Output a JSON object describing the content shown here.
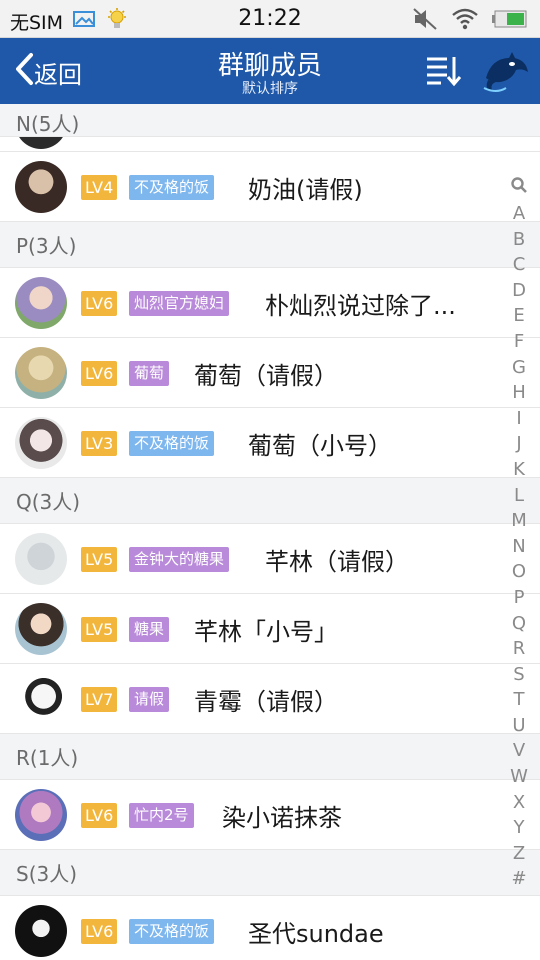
{
  "status": {
    "carrier": "无SIM",
    "time": "21:22"
  },
  "header": {
    "back_label": "返回",
    "title": "群聊成员",
    "subtitle": "默认排序"
  },
  "colors": {
    "header_bg": "#1f58a8",
    "lv_badge": "#f2b63c",
    "tag_blue": "#7eb6ee",
    "tag_purple": "#b88ad9"
  },
  "sections": [
    {
      "label": "N(5人)"
    },
    {
      "label": "P(3人)"
    },
    {
      "label": "Q(3人)"
    },
    {
      "label": "R(1人)"
    },
    {
      "label": "S(3人)"
    }
  ],
  "members": [
    {
      "level": "LV4",
      "tag": "不及格的饭",
      "name": "奶油(请假)"
    },
    {
      "level": "LV6",
      "tag": "灿烈官方媳妇",
      "name": "朴灿烈说过除了..."
    },
    {
      "level": "LV6",
      "tag": "葡萄",
      "name": "葡萄（请假）"
    },
    {
      "level": "LV3",
      "tag": "不及格的饭",
      "name": "葡萄（小号）"
    },
    {
      "level": "LV5",
      "tag": "金钟大的糖果",
      "name": "芊林（请假）"
    },
    {
      "level": "LV5",
      "tag": "糖果",
      "name": "芊林「小号」"
    },
    {
      "level": "LV7",
      "tag": "请假",
      "name": "青霉（请假）"
    },
    {
      "level": "LV6",
      "tag": "忙内2号",
      "name": "染小诺抹茶"
    },
    {
      "level": "LV6",
      "tag": "不及格的饭",
      "name": "圣代sundae"
    }
  ],
  "index_letters": [
    "A",
    "B",
    "C",
    "D",
    "E",
    "F",
    "G",
    "H",
    "I",
    "J",
    "K",
    "L",
    "M",
    "N",
    "O",
    "P",
    "Q",
    "R",
    "S",
    "T",
    "U",
    "V",
    "W",
    "X",
    "Y",
    "Z",
    "#"
  ],
  "icons": [
    "image-icon",
    "bulb-icon",
    "mute-icon",
    "wifi-icon",
    "battery-icon",
    "back-chevron-icon",
    "sort-icon",
    "dolphin-avatar-icon",
    "search-icon"
  ]
}
